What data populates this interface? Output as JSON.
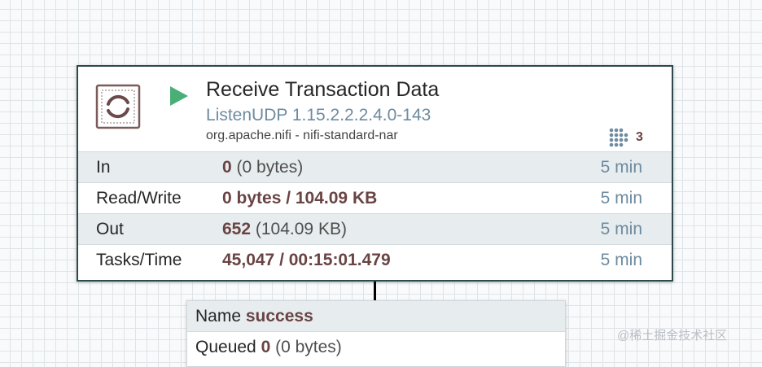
{
  "processor": {
    "name": "Receive Transaction Data",
    "type": "ListenUDP 1.15.2.2.2.4.0-143",
    "bundle": "org.apache.nifi - nifi-standard-nar",
    "active_threads": "3",
    "status_icon": "play-icon",
    "stats": [
      {
        "label": "In",
        "value_bold": "0",
        "value_rest": " (0 bytes)",
        "time": "5 min"
      },
      {
        "label": "Read/Write",
        "value_bold": "0 bytes / 104.09 KB",
        "value_rest": "",
        "time": "5 min"
      },
      {
        "label": "Out",
        "value_bold": "652",
        "value_rest": " (104.09 KB)",
        "time": "5 min"
      },
      {
        "label": "Tasks/Time",
        "value_bold": "45,047 / 00:15:01.479",
        "value_rest": "",
        "time": "5 min"
      }
    ]
  },
  "connection": {
    "name_label": "Name",
    "name_value": "success",
    "queued_label": "Queued",
    "queued_count": "0",
    "queued_size": " (0 bytes)"
  },
  "watermark": "@稀土掘金技术社区",
  "colors": {
    "border": "#2c4a4a",
    "run_green": "#4aaf77",
    "value_maroon": "#6a4343",
    "type_blue": "#6e8ba0"
  }
}
